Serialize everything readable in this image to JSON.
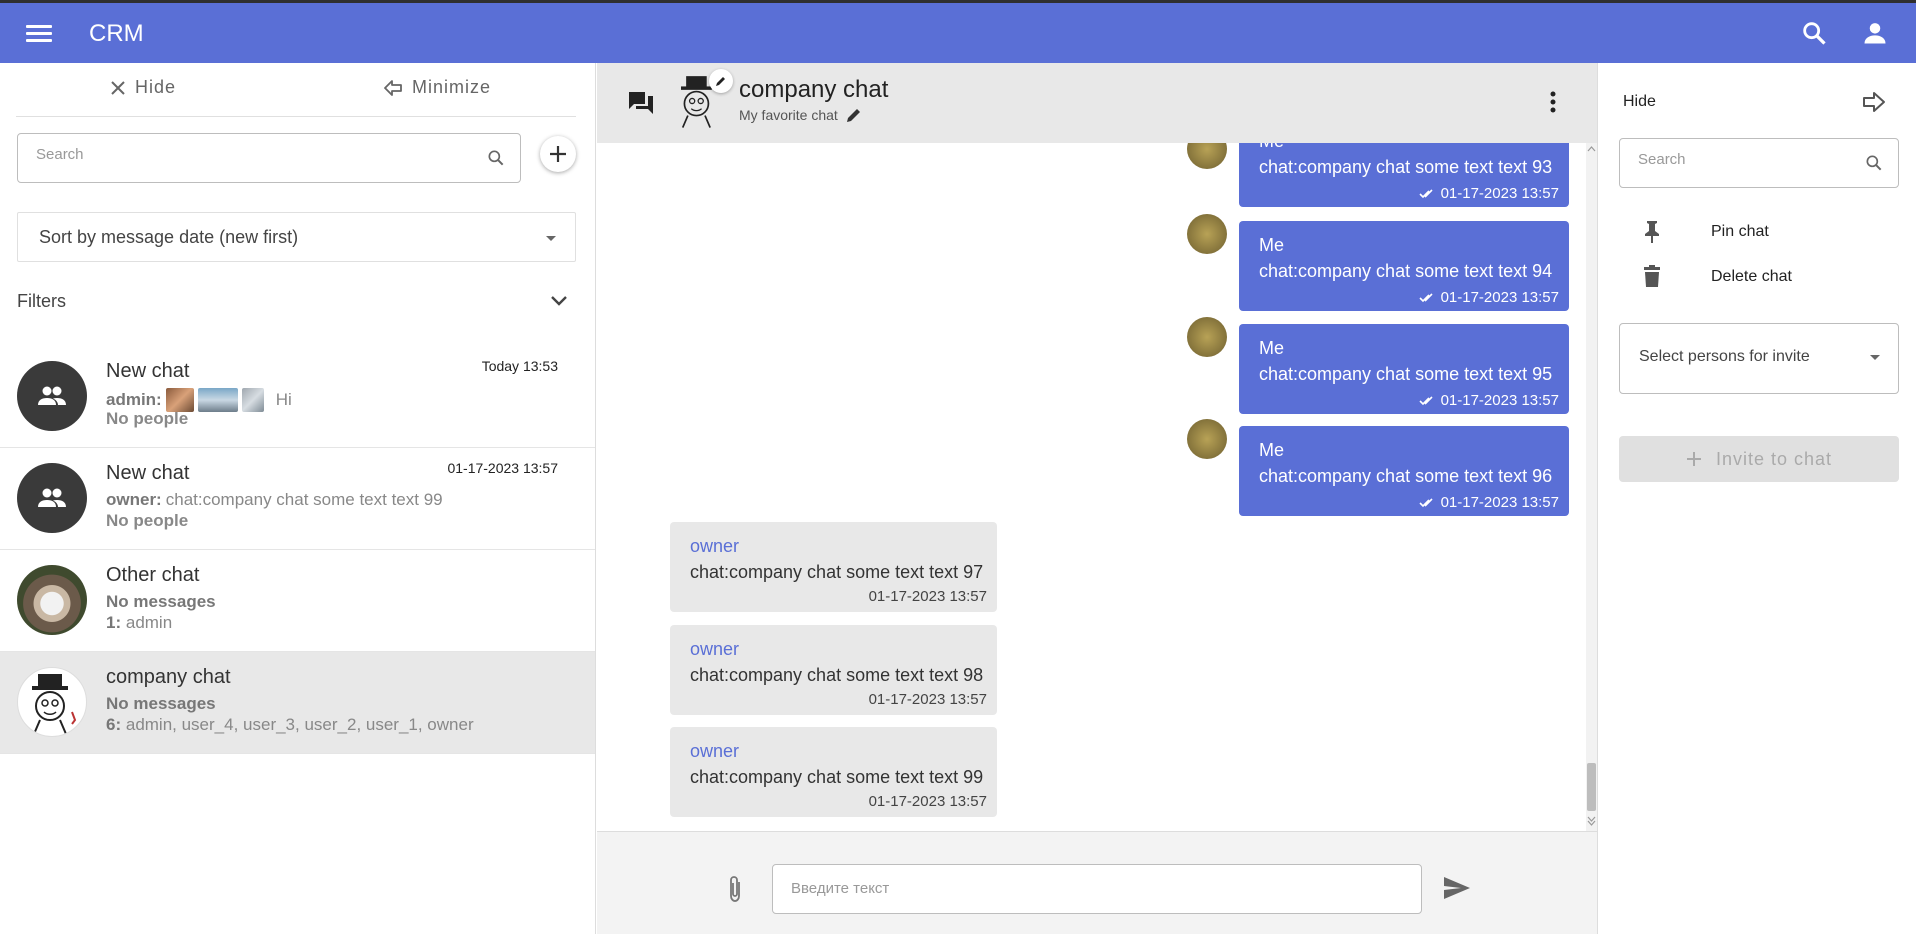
{
  "app": {
    "title": "CRM"
  },
  "left": {
    "hide_label": "Hide",
    "minimize_label": "Minimize",
    "search_placeholder": "Search",
    "sort_value": "Sort by message date (new first)",
    "filters_label": "Filters",
    "chats": [
      {
        "name": "New chat",
        "time": "Today 13:53",
        "line2_prefix": "admin:",
        "line2_text": "Hi",
        "line3_text": "No people",
        "active": false
      },
      {
        "name": "New chat",
        "time": "01-17-2023 13:57",
        "line2_prefix": "owner:",
        "line2_text": "chat:company chat some text text 99",
        "line3_text": "No people",
        "active": false
      },
      {
        "name": "Other chat",
        "time": "",
        "line2_prefix": "",
        "line2_text": "No messages",
        "line3_prefix": "1:",
        "line3_text": "admin",
        "active": false
      },
      {
        "name": "company chat",
        "time": "",
        "line2_prefix": "",
        "line2_text": "No messages",
        "line3_prefix": "6:",
        "line3_text": "admin, user_4, user_3, user_2, user_1, owner",
        "active": true
      }
    ]
  },
  "center": {
    "chat_title": "company chat",
    "chat_subtitle": "My favorite chat",
    "composer_placeholder": "Введите текст",
    "messages": [
      {
        "from": "Me",
        "mine": true,
        "text": "chat:company chat some text text 93",
        "time": "01-17-2023 13:57"
      },
      {
        "from": "Me",
        "mine": true,
        "text": "chat:company chat some text text 94",
        "time": "01-17-2023 13:57"
      },
      {
        "from": "Me",
        "mine": true,
        "text": "chat:company chat some text text 95",
        "time": "01-17-2023 13:57"
      },
      {
        "from": "Me",
        "mine": true,
        "text": "chat:company chat some text text 96",
        "time": "01-17-2023 13:57"
      },
      {
        "from": "owner",
        "mine": false,
        "text": "chat:company chat some text text 97",
        "time": "01-17-2023 13:57"
      },
      {
        "from": "owner",
        "mine": false,
        "text": "chat:company chat some text text 98",
        "time": "01-17-2023 13:57"
      },
      {
        "from": "owner",
        "mine": false,
        "text": "chat:company chat some text text 99",
        "time": "01-17-2023 13:57"
      }
    ]
  },
  "right": {
    "hide_label": "Hide",
    "search_placeholder": "Search",
    "pin_label": "Pin chat",
    "delete_label": "Delete chat",
    "invite_select_placeholder": "Select persons for invite",
    "invite_button_label": "Invite to chat"
  },
  "icons": {
    "menu": "menu-icon",
    "search": "search-icon",
    "account": "account-icon",
    "close": "close-icon",
    "minimize": "arrow-left-icon",
    "add": "plus-icon",
    "chevron": "chevron-down-icon",
    "group": "group-icon",
    "forum": "forum-icon",
    "edit": "pencil-icon",
    "more": "more-vert-icon",
    "double_check": "double-check-icon",
    "attach": "paperclip-icon",
    "send": "send-icon",
    "pin": "pin-icon",
    "delete": "trash-icon",
    "exit": "arrow-right-icon"
  },
  "colors": {
    "primary": "#5a6fd6",
    "bubble_other": "#e8e8e8",
    "active_item": "#e8e8e8"
  }
}
